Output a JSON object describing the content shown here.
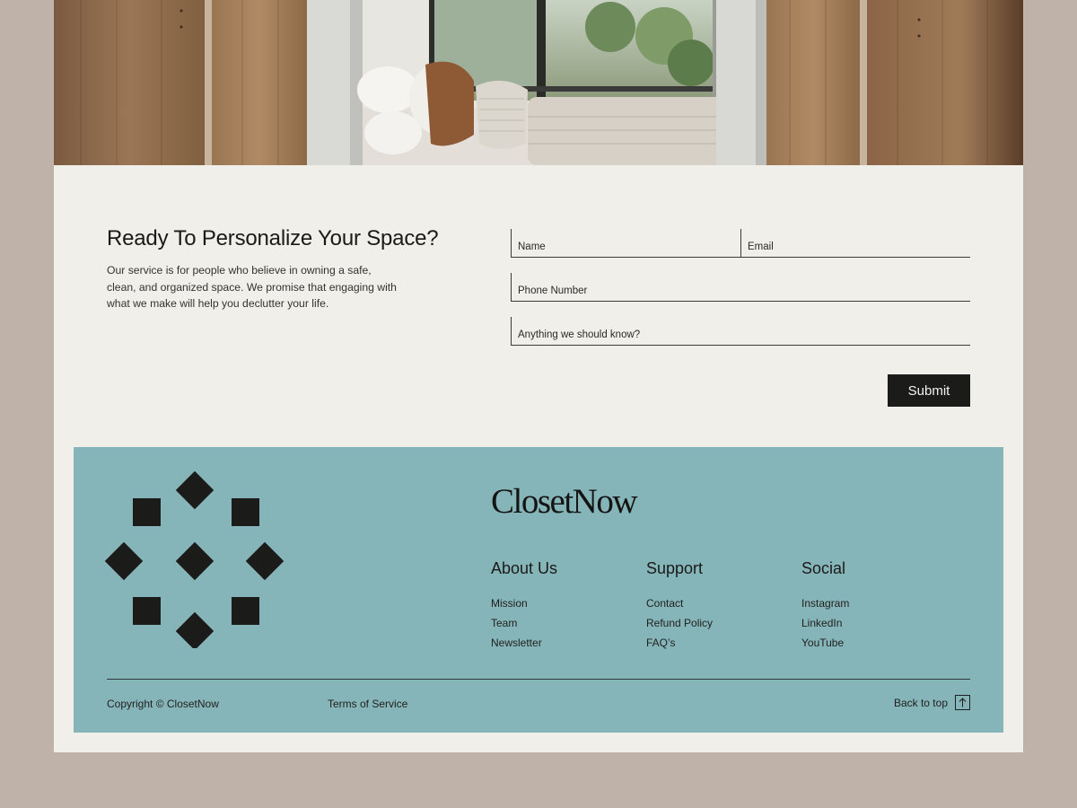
{
  "contact": {
    "title": "Ready To Personalize Your Space?",
    "description": "Our service is for people who believe in owning a safe, clean, and organized space. We promise that engaging with what we make will help you declutter your life.",
    "form": {
      "name_placeholder": "Name",
      "email_placeholder": "Email",
      "phone_placeholder": "Phone Number",
      "notes_placeholder": "Anything we should know?",
      "submit_label": "Submit"
    }
  },
  "footer": {
    "brand": "ClosetNow",
    "columns": [
      {
        "heading": "About Us",
        "links": [
          "Mission",
          "Team",
          "Newsletter"
        ]
      },
      {
        "heading": "Support",
        "links": [
          "Contact",
          "Refund Policy",
          "FAQ’s"
        ]
      },
      {
        "heading": "Social",
        "links": [
          "Instagram",
          "LinkedIn",
          "YouTube"
        ]
      }
    ],
    "copyright": "Copyright © ClosetNow",
    "terms": "Terms of Service",
    "back_to_top": "Back to top"
  },
  "colors": {
    "outer_background": "#bfb2a9",
    "page_background": "#f0efea",
    "footer_background": "#86b5b9",
    "button_background": "#1b1b1a"
  },
  "icons": [
    "logo-pattern-icon",
    "arrow-up-icon"
  ]
}
